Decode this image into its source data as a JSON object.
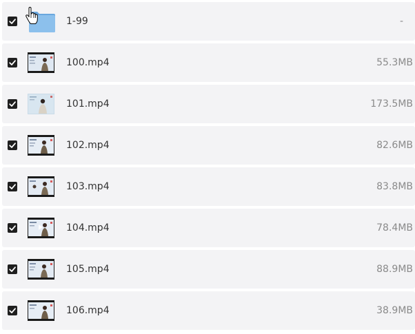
{
  "files": [
    {
      "name": "1-99",
      "size": "-",
      "type": "folder",
      "checked": true,
      "icon": "folder-icon"
    },
    {
      "name": "100.mp4",
      "size": "55.3MB",
      "type": "video",
      "checked": true,
      "icon": "video-thumbnail"
    },
    {
      "name": "101.mp4",
      "size": "173.5MB",
      "type": "video",
      "checked": true,
      "icon": "video-thumbnail"
    },
    {
      "name": "102.mp4",
      "size": "82.6MB",
      "type": "video",
      "checked": true,
      "icon": "video-thumbnail"
    },
    {
      "name": "103.mp4",
      "size": "83.8MB",
      "type": "video",
      "checked": true,
      "icon": "video-thumbnail"
    },
    {
      "name": "104.mp4",
      "size": "78.4MB",
      "type": "video",
      "checked": true,
      "icon": "video-thumbnail"
    },
    {
      "name": "105.mp4",
      "size": "88.9MB",
      "type": "video",
      "checked": true,
      "icon": "video-thumbnail"
    },
    {
      "name": "106.mp4",
      "size": "38.9MB",
      "type": "video",
      "checked": true,
      "icon": "video-thumbnail"
    }
  ],
  "colors": {
    "row_background": "#f3f3f5",
    "checkbox": "#1f1f1f",
    "folder": "#7db4e6",
    "name_text": "#333333",
    "size_text": "#8a8a8a"
  },
  "cursor": "hand-pointer-icon"
}
